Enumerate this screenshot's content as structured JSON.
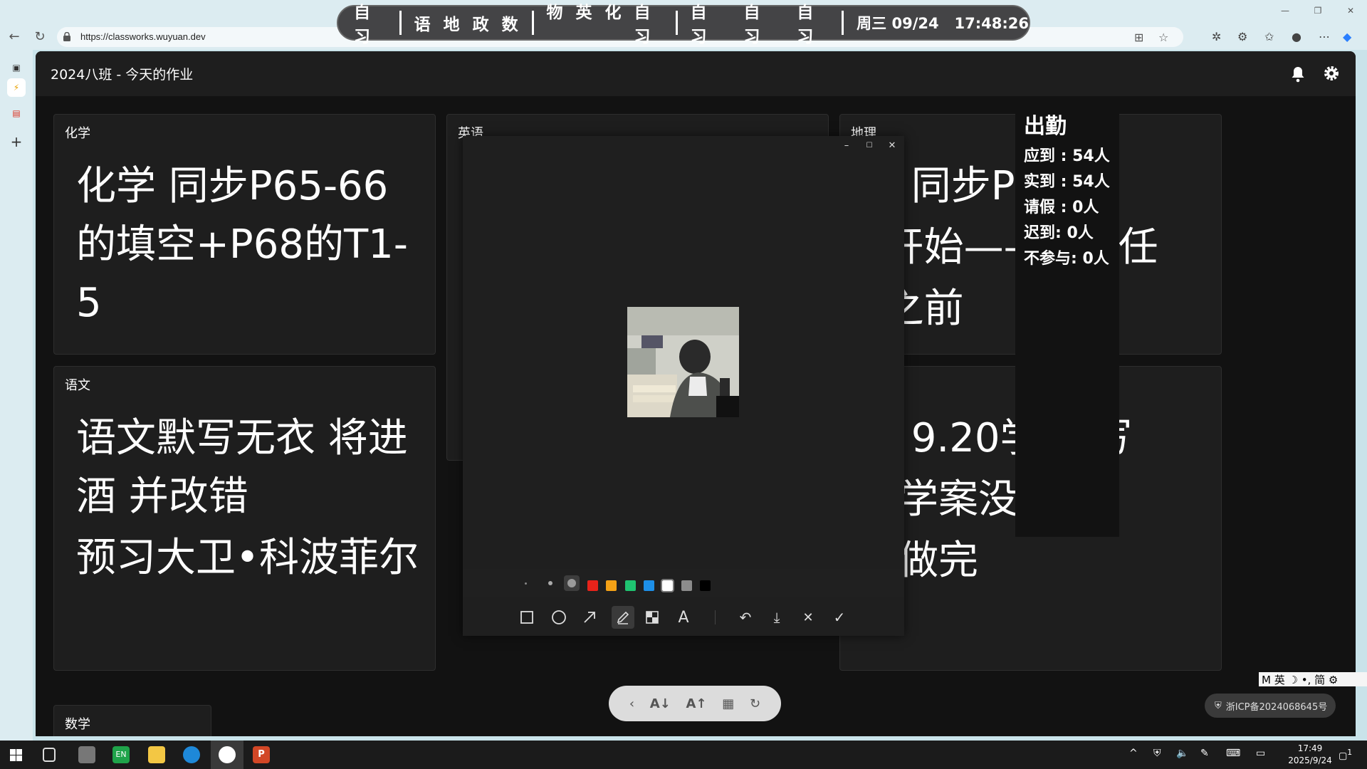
{
  "browser": {
    "url": "https://classworks.wuyuan.dev"
  },
  "classbar": {
    "groups": [
      [
        "自习"
      ],
      [
        "语",
        "地",
        "政",
        "数"
      ],
      [
        "物",
        "英",
        "化",
        "自习"
      ],
      [
        "自习",
        "自习",
        "自习"
      ]
    ],
    "datetime": "周三 09/24   17:48:26"
  },
  "app": {
    "title": "2024八班 - 今天的作业"
  },
  "cards": [
    {
      "subject": "化学",
      "lines": [
        "化学 同步P65-66的填空+P68的T1-5"
      ]
    },
    {
      "subject": "英语",
      "lines": []
    },
    {
      "subject": "地理",
      "lines": [
        "理 同步P49任",
        "2开始——P52任",
        "2之前"
      ]
    },
    {
      "subject": "语文",
      "lines": [
        "语文默写无衣 将进酒 并改错",
        "预习大卫•科波菲尔"
      ]
    },
    {
      "subject": "",
      "lines": [
        "理 9.20学案 写",
        "",
        "读学案没做完",
        "的做完"
      ]
    },
    {
      "subject": "数学",
      "lines": []
    }
  ],
  "attendance": {
    "heading": "出勤",
    "lines": [
      "应到 : 54人",
      "实到 : 54人",
      "请假 : 0人",
      "迟到: 0人",
      "不参与: 0人"
    ]
  },
  "dialog": {
    "palette_colors": [
      "#e8231a",
      "#f5a216",
      "#1fc471",
      "#1d8fe8",
      "#ffffff",
      "#8c8c8c",
      "#000000"
    ]
  },
  "footer": {
    "icp": "浙ICP备2024068645号",
    "ime": "M 英 ☽ •, 简 ⚙"
  },
  "taskbar": {
    "time": "17:49",
    "date": "2025/9/24",
    "notification_count": "1"
  }
}
